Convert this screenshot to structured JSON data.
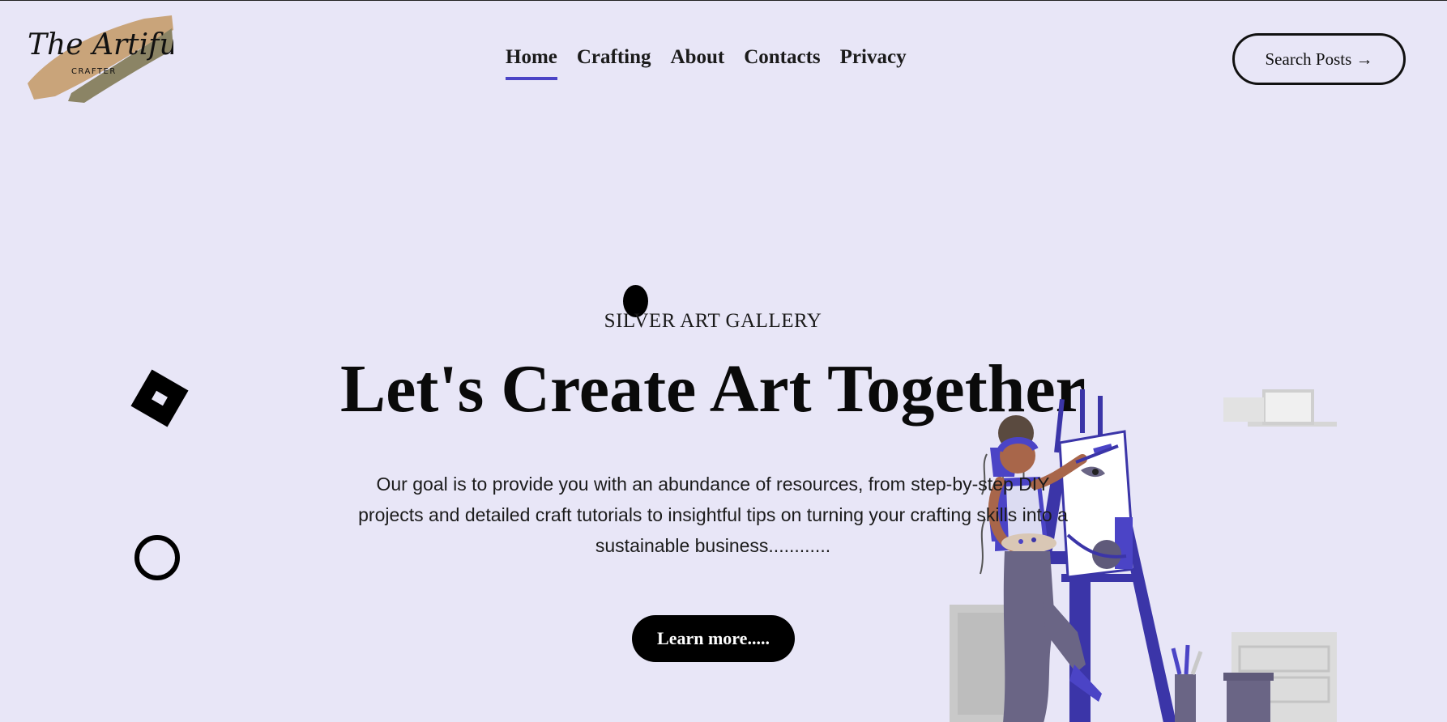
{
  "logo": {
    "script": "The Artiful",
    "tagline": "CRAFTER"
  },
  "nav": {
    "items": [
      {
        "label": "Home",
        "active": true
      },
      {
        "label": "Crafting",
        "active": false
      },
      {
        "label": "About",
        "active": false
      },
      {
        "label": "Contacts",
        "active": false
      },
      {
        "label": "Privacy",
        "active": false
      }
    ]
  },
  "header": {
    "search_label": "Search Posts →"
  },
  "hero": {
    "eyebrow": "SILVER ART GALLERY",
    "title": "Let's Create Art Together",
    "description": "Our goal is to provide you with an abundance of resources, from step-by-step DIY projects and detailed craft tutorials to insightful tips on turning your crafting skills into a sustainable business............",
    "cta_label": "Learn more....."
  },
  "colors": {
    "background": "#e8e6f7",
    "accent": "#4b44c6",
    "text": "#0a0a0a"
  }
}
